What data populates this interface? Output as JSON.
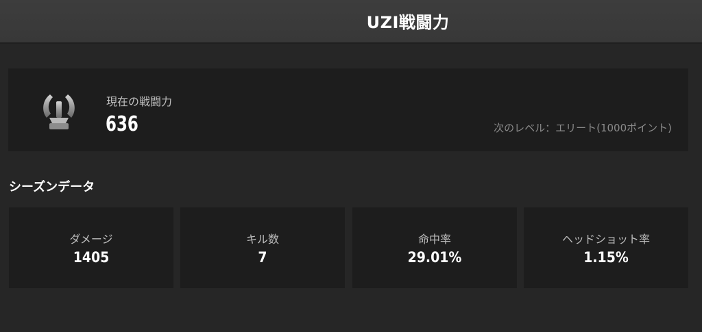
{
  "header": {
    "title": "UZI戦闘力"
  },
  "power": {
    "icon": "rank-emblem-icon",
    "label": "現在の戦闘力",
    "value": "636",
    "next_level": "次のレベル：エリート(1000ポイント)"
  },
  "season": {
    "title": "シーズンデータ",
    "stats": [
      {
        "label": "ダメージ",
        "value": "1405"
      },
      {
        "label": "キル数",
        "value": "7"
      },
      {
        "label": "命中率",
        "value": "29.01%"
      },
      {
        "label": "ヘッドショット率",
        "value": "1.15%"
      }
    ]
  },
  "colors": {
    "background": "#262626",
    "header": "#3a3a3a",
    "card": "#1d1d1d",
    "label": "#bdbdbd",
    "muted": "#8a8a8a",
    "value": "#ffffff"
  }
}
